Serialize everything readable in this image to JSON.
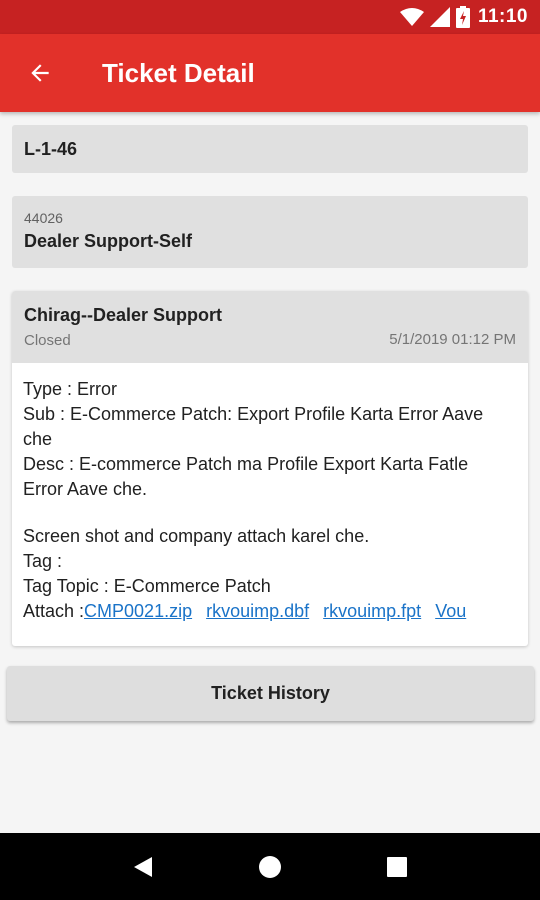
{
  "status_bar": {
    "time": "11:10",
    "icons": [
      "wifi-icon",
      "signal-icon",
      "battery-icon"
    ]
  },
  "app_bar": {
    "title": "Ticket Detail",
    "back_icon": "arrow-back-icon"
  },
  "ticket_code": "L-1-46",
  "customer": {
    "number": "44026",
    "name": "Dealer Support-Self"
  },
  "detail": {
    "name": "Chirag--Dealer Support",
    "status": "Closed",
    "date": "5/1/2019 01:12 PM",
    "type": "Type : Error",
    "sub_line1": "Sub : E-Commerce Patch: Export Profile Karta Error Aave",
    "sub_line2": "che",
    "desc_line1": "Desc : E-commerce Patch ma Profile Export Karta Fatle",
    "desc_line2": "Error Aave che.",
    "note": "Screen shot and company attach karel che.",
    "tag": "Tag :",
    "tag_topic": "Tag Topic : E-Commerce Patch",
    "attach_label": "Attach :",
    "attachments": [
      "CMP0021.zip",
      "rkvouimp.dbf",
      "rkvouimp.fpt",
      "Vou"
    ]
  },
  "history_button": "Ticket History",
  "colors": {
    "status_bar": "#c62222",
    "app_bar": "#e2312a",
    "link": "#1a73c8"
  }
}
